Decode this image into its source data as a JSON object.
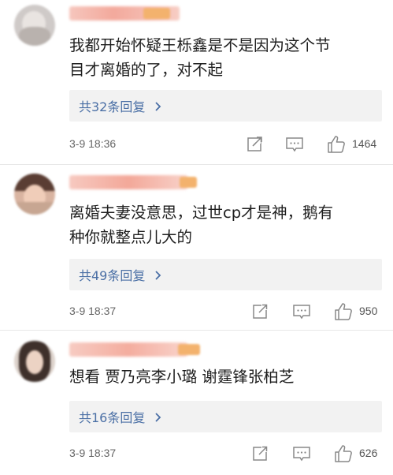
{
  "comments": [
    {
      "content_line1": "我都开始怀疑王栎鑫是不是因为这个节",
      "content_line2": "目才离婚的了，对不起",
      "replies_label": "共32条回复",
      "time": "3-9 18:36",
      "like_count": "1464"
    },
    {
      "content_line1": "离婚夫妻没意思，过世cp才是神，鹅有",
      "content_line2": "种你就整点儿大的",
      "replies_label": "共49条回复",
      "time": "3-9 18:37",
      "like_count": "950"
    },
    {
      "content_line1": "想看 贾乃亮李小璐 谢霆锋张柏芝",
      "replies_label": "共16条回复",
      "time": "3-9 18:37",
      "like_count": "626"
    }
  ],
  "colors": {
    "link_blue": "#4a6fa5",
    "reply_bg": "#f2f2f2",
    "icon_gray": "#888888",
    "username_blur": "#f4b8ad",
    "badge_blur": "#f5c08a"
  },
  "icons": {
    "share": "share-icon",
    "comment": "comment-icon",
    "like": "thumbs-up-icon",
    "chevron": "chevron-right-icon"
  }
}
